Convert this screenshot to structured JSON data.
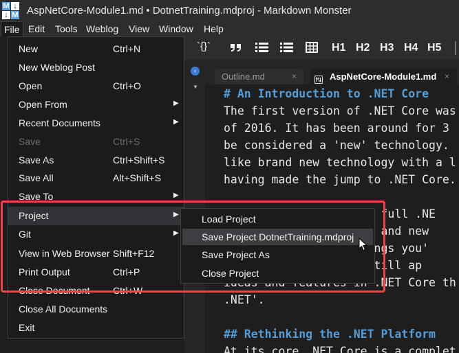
{
  "window": {
    "title": "AspNetCore-Module1.md • DotnetTraining.mdproj  -  Markdown Monster"
  },
  "menubar": [
    "File",
    "Edit",
    "Tools",
    "Weblog",
    "View",
    "Window",
    "Help"
  ],
  "toolbar": {
    "code_label": "`{}`",
    "h1": "H1",
    "h2": "H2",
    "h3": "H3",
    "h4": "H4",
    "h5": "H5"
  },
  "tabs": [
    {
      "label": "Outline.md",
      "close": "×"
    },
    {
      "label": "AspNetCore-Module1.md",
      "close": "×"
    }
  ],
  "editor_lines": [
    "# An Introduction to .NET Core",
    "The first version of .NET Core was",
    "of 2016. It has been around for 3",
    "be considered a 'new' technology.",
    "like brand new technology with a l",
    "having made the jump to .NET Core.",
    "",
    "                   the full .NE",
    "                  liar and new",
    "                   things you'",
    "                ment still ap",
    "ideas and features in .NET Core th",
    ".NET'.",
    "",
    "## Rethinking the .NET Platform",
    "At its core .NET Core is a complet"
  ],
  "file_menu": [
    {
      "label": "New",
      "shortcut": "Ctrl+N"
    },
    {
      "label": "New Weblog Post",
      "shortcut": ""
    },
    {
      "label": "Open",
      "shortcut": "Ctrl+O"
    },
    {
      "label": "Open From",
      "shortcut": "",
      "submenu": true
    },
    {
      "label": "Recent Documents",
      "shortcut": "",
      "submenu": true
    },
    {
      "label": "Save",
      "shortcut": "Ctrl+S",
      "disabled": true
    },
    {
      "label": "Save As",
      "shortcut": "Ctrl+Shift+S"
    },
    {
      "label": "Save All",
      "shortcut": "Alt+Shift+S"
    },
    {
      "label": "Save To",
      "shortcut": "",
      "submenu": true
    },
    {
      "label": "Project",
      "shortcut": "",
      "submenu": true,
      "highlighted": true
    },
    {
      "label": "Git",
      "shortcut": "",
      "submenu": true
    },
    {
      "label": "View in Web Browser",
      "shortcut": "Shift+F12"
    },
    {
      "label": "Print Output",
      "shortcut": "Ctrl+P"
    },
    {
      "label": "Close Document",
      "shortcut": "Ctrl+W"
    },
    {
      "label": "Close All Documents",
      "shortcut": ""
    },
    {
      "label": "Exit",
      "shortcut": ""
    }
  ],
  "project_submenu": [
    {
      "label": "Load Project"
    },
    {
      "label": "Save Project DotnetTraining.mdproj",
      "highlighted": true
    },
    {
      "label": "Save Project As"
    },
    {
      "label": "Close Project"
    }
  ],
  "colors": {
    "accent_frame": "#e8484b",
    "markdown_heading": "#569cd6",
    "menu_background": "#1b1b1c"
  }
}
